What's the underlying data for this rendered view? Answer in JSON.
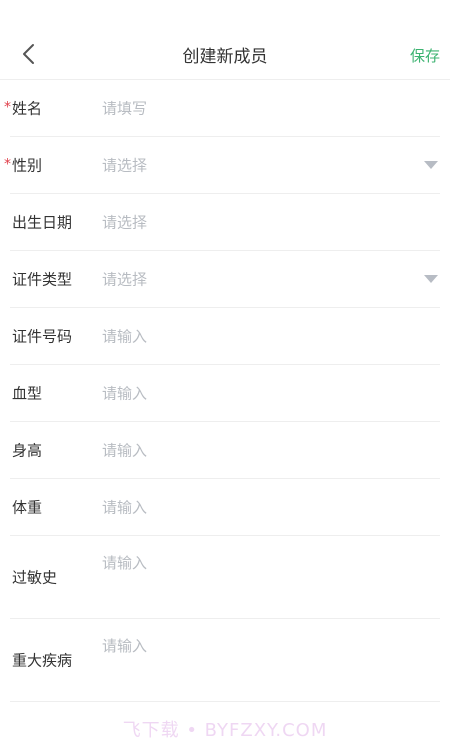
{
  "header": {
    "title": "创建新成员",
    "save_label": "保存"
  },
  "form": {
    "fields": [
      {
        "label": "姓名",
        "placeholder": "请填写",
        "required": true
      },
      {
        "label": "性别",
        "placeholder": "请选择",
        "required": true
      },
      {
        "label": "出生日期",
        "placeholder": "请选择"
      },
      {
        "label": "证件类型",
        "placeholder": "请选择"
      },
      {
        "label": "证件号码",
        "placeholder": "请输入"
      },
      {
        "label": "血型",
        "placeholder": "请输入"
      },
      {
        "label": "身高",
        "placeholder": "请输入"
      },
      {
        "label": "体重",
        "placeholder": "请输入"
      },
      {
        "label": "过敏史",
        "placeholder": "请输入"
      },
      {
        "label": "重大疾病",
        "placeholder": "请输入"
      }
    ]
  },
  "required_mark": "*",
  "watermark": "飞下载 • BYFZXY.COM",
  "colors": {
    "accent": "#3cb371",
    "required": "#e0404b",
    "placeholder": "#b8bcc2",
    "divider": "#eeeeee"
  }
}
